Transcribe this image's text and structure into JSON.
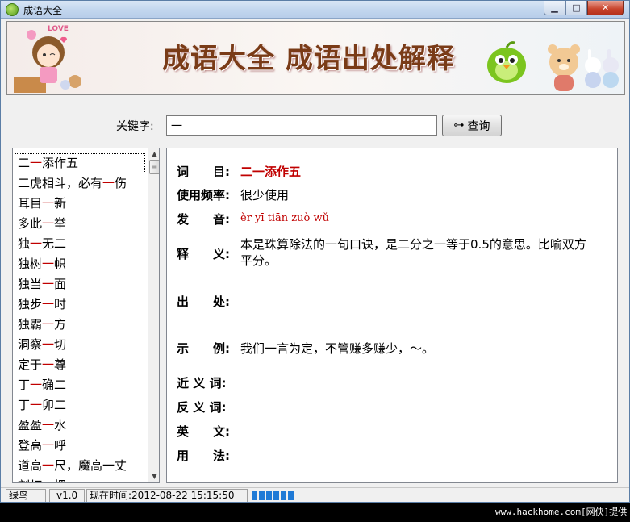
{
  "window": {
    "title": "成语大全"
  },
  "banner": {
    "title": "成语大全 成语出处解释",
    "badge_text": "LOVE"
  },
  "search": {
    "label": "关键字:",
    "value": "一",
    "button_label": "查询"
  },
  "list": {
    "items": [
      {
        "pre": "二",
        "hl": "一",
        "post": "添作五",
        "selected": true
      },
      {
        "pre": "二虎相斗，必有",
        "hl": "一",
        "post": "伤"
      },
      {
        "pre": "耳目",
        "hl": "一",
        "post": "新"
      },
      {
        "pre": "多此",
        "hl": "一",
        "post": "举"
      },
      {
        "pre": "独",
        "hl": "一",
        "post": "无二"
      },
      {
        "pre": "独树",
        "hl": "一",
        "post": "帜"
      },
      {
        "pre": "独当",
        "hl": "一",
        "post": "面"
      },
      {
        "pre": "独步",
        "hl": "一",
        "post": "时"
      },
      {
        "pre": "独霸",
        "hl": "一",
        "post": "方"
      },
      {
        "pre": "洞察",
        "hl": "一",
        "post": "切"
      },
      {
        "pre": "定于",
        "hl": "一",
        "post": "尊"
      },
      {
        "pre": "丁",
        "hl": "一",
        "post": "确二"
      },
      {
        "pre": "丁",
        "hl": "一",
        "post": "卯二"
      },
      {
        "pre": "盈盈",
        "hl": "一",
        "post": "水"
      },
      {
        "pre": "登高",
        "hl": "一",
        "post": "呼"
      },
      {
        "pre": "道高",
        "hl": "一",
        "post": "尺，魔高一丈"
      },
      {
        "pre": "刻打",
        "hl": "一",
        "post": "把"
      }
    ]
  },
  "detail": {
    "word_label": "词　　目:",
    "word": "二一添作五",
    "freq_label": "使用频率:",
    "freq": "很少使用",
    "pinyin_label": "发　　音:",
    "pinyin": "èr yī tiān zuò wǔ",
    "meaning_label": "释　　义:",
    "meaning": "本是珠算除法的一句口诀，是二分之一等于0.5的意思。比喻双方平分。",
    "source_label": "出　　处:",
    "source": "",
    "example_label": "示　　例:",
    "example": "我们一言为定，不管赚多赚少，～。",
    "synonym_label": "近 义 词:",
    "antonym_label": "反 义 词:",
    "english_label": "英　　文:",
    "usage_label": "用　　法:"
  },
  "status": {
    "name": "绿鸟",
    "version": "v1.0",
    "time": "现在时间:2012-08-22 15:15:50",
    "progress_segments": 6
  },
  "watermark": "www.hackhome.com[网侠]提供",
  "colors": {
    "highlight": "#c00000",
    "progress": "#1f7ad6"
  }
}
